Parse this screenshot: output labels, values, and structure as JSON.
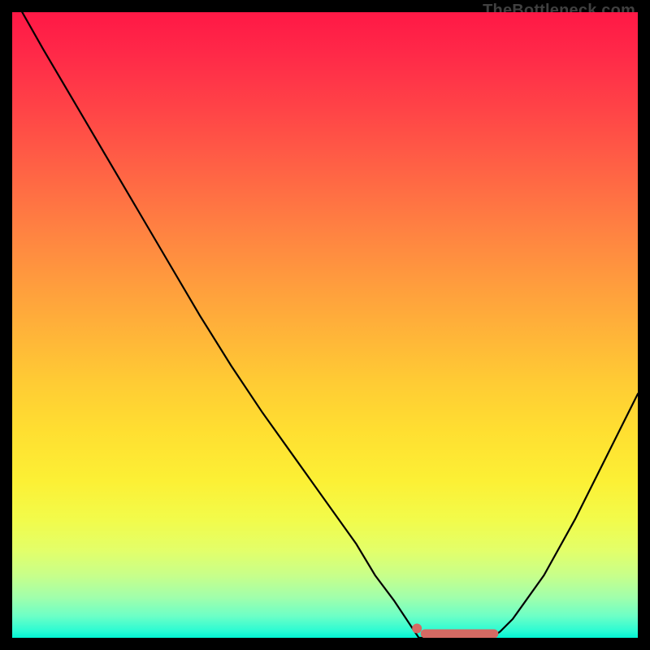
{
  "attribution": "TheBottleneck.com",
  "colors": {
    "border": "#000000",
    "curve": "#000000",
    "marker": "#d46a63",
    "attribution": "#404040"
  },
  "chart_data": {
    "type": "line",
    "title": "",
    "xlabel": "",
    "ylabel": "",
    "xlim": [
      0,
      100
    ],
    "ylim": [
      0,
      100
    ],
    "series": [
      {
        "name": "main-curve",
        "x": [
          1.6,
          5,
          10,
          15,
          20,
          25,
          30,
          35,
          40,
          45,
          50,
          55,
          58,
          61,
          63,
          64,
          65,
          70,
          75,
          77,
          78,
          80,
          85,
          90,
          95,
          100
        ],
        "y": [
          100,
          94,
          85.5,
          77,
          68.5,
          60,
          51.5,
          43.5,
          36,
          29,
          22,
          15,
          10,
          6,
          3,
          1.5,
          0,
          0,
          0,
          0.3,
          1,
          3,
          10,
          19,
          29,
          39
        ]
      }
    ],
    "markers": {
      "dot": {
        "x": 64.7,
        "y": 1.5
      },
      "band": {
        "x1": 66,
        "x2": 77,
        "y": 0.65
      }
    },
    "gradient_stops_percent_top_to_bottom": [
      {
        "pct": 0,
        "hex": "#ff1846"
      },
      {
        "pct": 25,
        "hex": "#ff6245"
      },
      {
        "pct": 50,
        "hex": "#ffb339"
      },
      {
        "pct": 75,
        "hex": "#f2fb4a"
      },
      {
        "pct": 100,
        "hex": "#02f3d3"
      }
    ]
  }
}
